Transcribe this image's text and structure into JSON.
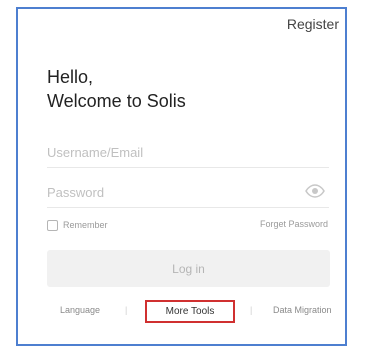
{
  "header": {
    "register_label": "Register"
  },
  "greeting": {
    "line1": "Hello,",
    "line2": "Welcome to Solis"
  },
  "form": {
    "username_placeholder": "Username/Email",
    "password_placeholder": "Password",
    "remember_label": "Remember",
    "forget_label": "Forget Password",
    "login_label": "Log in"
  },
  "footer": {
    "language": "Language",
    "separator": "|",
    "more_tools": "More Tools",
    "data_migration": "Data Migration"
  },
  "colors": {
    "frame": "#4d7fd0",
    "highlight": "#d03030"
  },
  "icons": {
    "password_toggle": "eye-icon"
  }
}
